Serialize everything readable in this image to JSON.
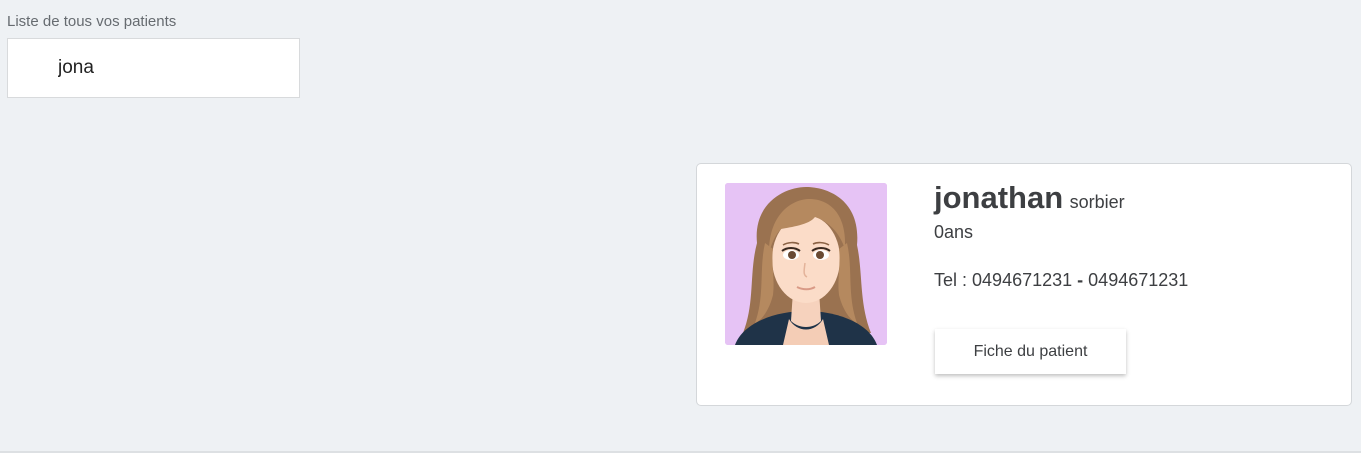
{
  "search": {
    "label": "Liste de tous vos patients",
    "value": "jona"
  },
  "patient": {
    "first_name": "jonathan",
    "last_name": "sorbier",
    "age": "0ans",
    "phone_label": "Tel :",
    "phone_1": "0494671231",
    "phone_separator": "-",
    "phone_2": "0494671231",
    "avatar_bg": "#e6c3f5",
    "button_label": "Fiche du patient"
  }
}
